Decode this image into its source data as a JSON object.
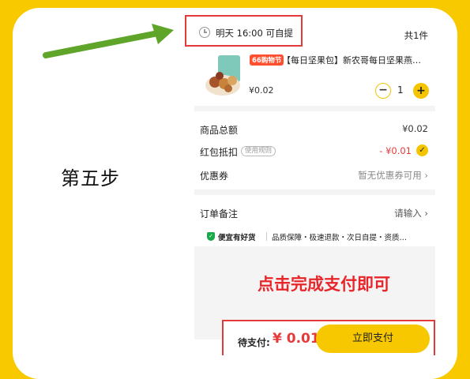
{
  "step_label": "第五步",
  "annotation": "点击完成支付即可",
  "header": {
    "pickup_time": "明天 16:00 可自提",
    "item_count": "共1件"
  },
  "product": {
    "promo_tag": "66购物节",
    "title": "【每日坚果包】新农哥每日坚果燕…",
    "price": "¥0.02",
    "quantity": "1",
    "minus": "−",
    "plus": "+"
  },
  "summary": {
    "total_label": "商品总额",
    "total_value": "¥0.02",
    "redpacket_label": "红包抵扣",
    "redpacket_rules": "使用规则",
    "redpacket_value": "- ¥0.01",
    "coupon_label": "优惠券",
    "coupon_value": "暂无优惠券可用"
  },
  "remark": {
    "label": "订单备注",
    "value": "请输入"
  },
  "guarantee": {
    "title": "便宜有好货",
    "items": "品质保障・极速退款・次日自提・资质…"
  },
  "pay_bar": {
    "due_label": "待支付:",
    "due_amount": "¥ 0.01",
    "pay_button": "立即支付"
  },
  "colors": {
    "background": "#f9c900",
    "accent_yellow": "#f7c800",
    "highlight_red": "#e53a3a",
    "arrow_green": "#5ea52a"
  }
}
